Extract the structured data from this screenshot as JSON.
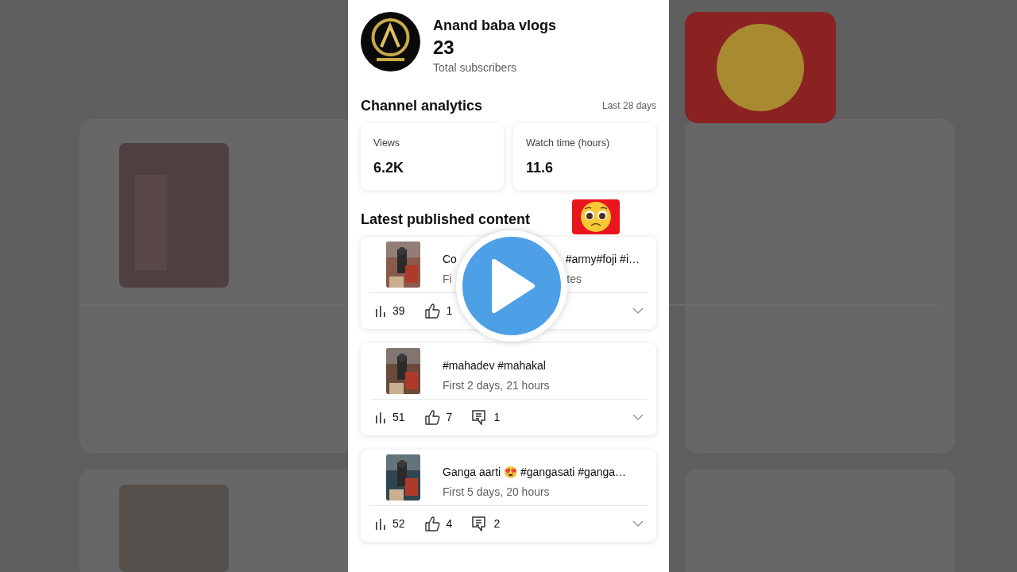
{
  "channel": {
    "name": "Anand baba vlogs",
    "subscribers": "23",
    "subscribers_label": "Total subscribers"
  },
  "analytics": {
    "title": "Channel analytics",
    "period": "Last 28 days",
    "stats": [
      {
        "label": "Views",
        "value": "6.2K"
      },
      {
        "label": "Watch time (hours)",
        "value": "11.6"
      }
    ]
  },
  "latest": {
    "title": "Latest published content",
    "items": [
      {
        "title": [
          "Co",
          "#army#foji #i…"
        ],
        "subtitle": [
          "Fi",
          "tes"
        ],
        "views": "39",
        "likes": "1"
      },
      {
        "title": [
          "#mahadev #mahakal"
        ],
        "subtitle": [
          "First 2 days, 21 hours"
        ],
        "views": "51",
        "likes": "7",
        "comments": "1"
      },
      {
        "title": [
          "Ganga aarti 😍 #gangasati #ganga…"
        ],
        "subtitle": [
          "First 5 days, 20 hours"
        ],
        "views": "52",
        "likes": "4",
        "comments": "2"
      }
    ]
  }
}
